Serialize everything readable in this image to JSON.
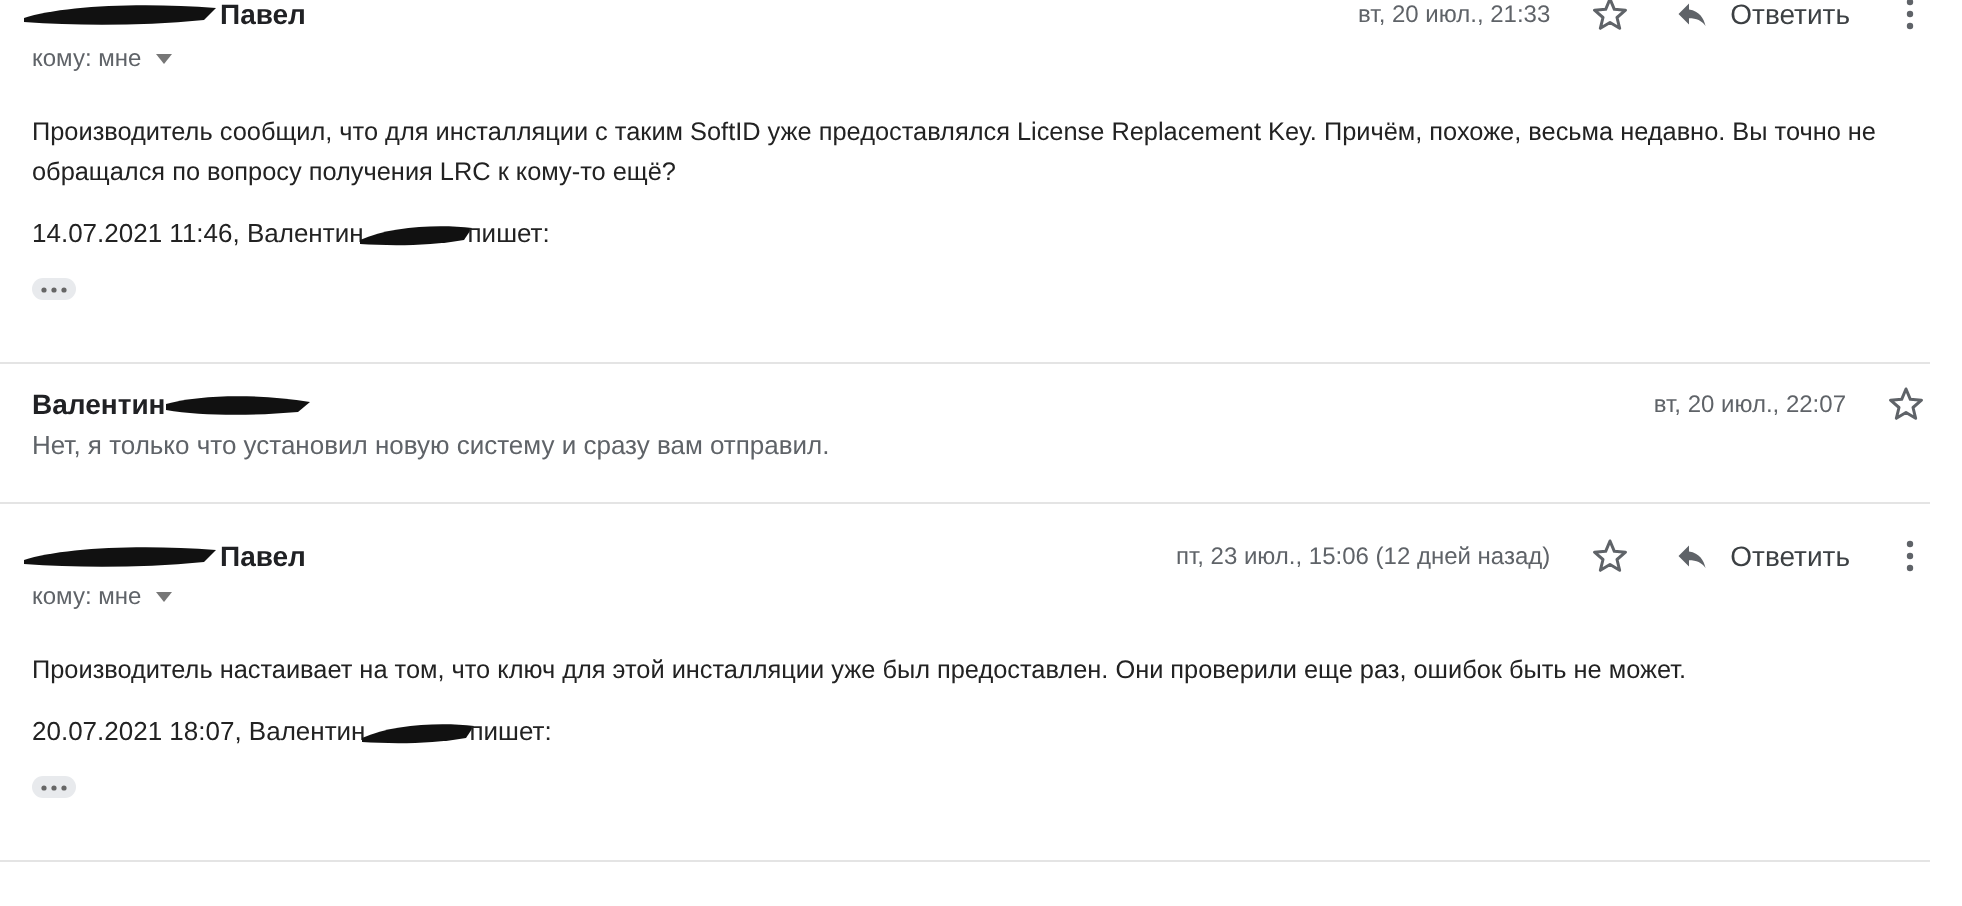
{
  "messages": [
    {
      "kind": "expanded",
      "sender": "Павел",
      "redacted_before": true,
      "recipient": "кому: мне",
      "date": "вт, 20 июл., 21:33",
      "starred": false,
      "reply_label": "Ответить",
      "body": "Производитель сообщил, что для инсталляции с таким SoftID уже предоставлялся License Replacement Key. Причём, похоже, весьма недавно. Вы точно не обращался по вопросу получения LRC к кому-то ещё?",
      "quote_before": "14.07.2021 11:46, Валентин",
      "quote_after": "пишет:"
    },
    {
      "kind": "collapsed",
      "sender": "Валентин",
      "redacted_after": true,
      "date": "вт, 20 июл., 22:07",
      "starred": false,
      "snippet": "Нет, я только что установил новую систему и сразу вам отправил."
    },
    {
      "kind": "expanded",
      "sender": "Павел",
      "redacted_before": true,
      "recipient": "кому: мне",
      "date": "пт, 23 июл., 15:06 (12 дней назад)",
      "starred": false,
      "reply_label": "Ответить",
      "body": "Производитель настаивает на том, что ключ для этой инсталляции уже был предоставлен. Они проверили еще раз, ошибок быть не может.",
      "quote_before": "20.07.2021 18:07, Валентин",
      "quote_after": "пишет:"
    }
  ]
}
